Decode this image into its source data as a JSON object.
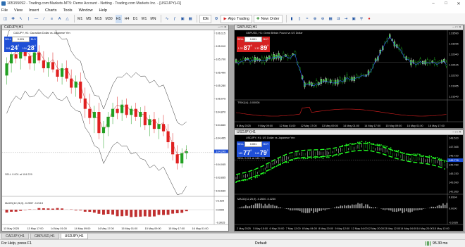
{
  "window": {
    "title": "105155092 - Trading.com:Markets-MT5: Demo Account - Netting - Trading.com Markets Inc. - [USDJPY,H1]"
  },
  "menu": [
    "File",
    "View",
    "Insert",
    "Charts",
    "Tools",
    "Window",
    "Help"
  ],
  "toolbar": {
    "timeframes": [
      "M1",
      "M5",
      "M15",
      "M30",
      "H1",
      "H4",
      "D1",
      "W1",
      "MN"
    ],
    "ide_label": "IDE",
    "algo_label": "Algo Trading",
    "new_order_label": "New Order"
  },
  "charts": [
    {
      "id": "cadjpy",
      "title": "CADJPY,H1",
      "symbol_line": "CADJPY, H1:  Canadian Dollar vs Japanese Yen",
      "otp": {
        "sell": "SELL",
        "buy": "BUY",
        "lot": "0.001",
        "bid_pre": "104",
        "bid_big": "24",
        "bid_sup": "3",
        "ask_pre": "104",
        "ask_big": "28",
        "ask_sup": "4"
      },
      "prices": [
        "106.115",
        "105.910",
        "105.700",
        "105.490",
        "105.280",
        "105.075",
        "104.870",
        "104.660",
        "104.455",
        "104.250",
        "104.045",
        "103.835",
        "103.630"
      ],
      "price_tag": "104.249",
      "sell_label": "SELL 0.001 at 104.229",
      "macd_label": "MACD(12,26,9) -0.2557 -0.2113",
      "macd_axis": [
        "0.1625",
        "0.0000",
        "-0.3025"
      ],
      "dates": [
        "13 May 2025",
        "13 May 17:00",
        "14 May 01:00",
        "14 May 09:00",
        "14 May 17:00",
        "15 May 01:00",
        "15 May 09:00",
        "15 May 17:00",
        "16 May 01:00"
      ],
      "candles": [
        {
          "o": 105.5,
          "h": 105.8,
          "l": 105.35,
          "c": 105.7
        },
        {
          "o": 105.7,
          "h": 105.95,
          "l": 105.55,
          "c": 105.85
        },
        {
          "o": 105.85,
          "h": 106.0,
          "l": 105.7,
          "c": 105.78
        },
        {
          "o": 105.78,
          "h": 105.95,
          "l": 105.6,
          "c": 105.9
        },
        {
          "o": 105.9,
          "h": 106.05,
          "l": 105.75,
          "c": 105.82
        },
        {
          "o": 105.82,
          "h": 105.95,
          "l": 105.6,
          "c": 105.7
        },
        {
          "o": 105.7,
          "h": 105.95,
          "l": 105.58,
          "c": 105.88
        },
        {
          "o": 105.88,
          "h": 106.0,
          "l": 105.7,
          "c": 105.75
        },
        {
          "o": 105.75,
          "h": 105.9,
          "l": 105.55,
          "c": 105.62
        },
        {
          "o": 105.62,
          "h": 105.8,
          "l": 105.48,
          "c": 105.72
        },
        {
          "o": 105.72,
          "h": 105.88,
          "l": 105.55,
          "c": 105.6
        },
        {
          "o": 105.6,
          "h": 105.75,
          "l": 105.4,
          "c": 105.48
        },
        {
          "o": 105.48,
          "h": 105.7,
          "l": 105.35,
          "c": 105.62
        },
        {
          "o": 105.62,
          "h": 105.75,
          "l": 105.4,
          "c": 105.45
        },
        {
          "o": 105.45,
          "h": 105.6,
          "l": 105.2,
          "c": 105.3
        },
        {
          "o": 105.3,
          "h": 105.5,
          "l": 105.15,
          "c": 105.4
        },
        {
          "o": 105.4,
          "h": 105.55,
          "l": 105.05,
          "c": 105.12
        },
        {
          "o": 105.12,
          "h": 105.3,
          "l": 104.8,
          "c": 104.95
        },
        {
          "o": 104.95,
          "h": 105.2,
          "l": 104.7,
          "c": 104.8
        },
        {
          "o": 104.8,
          "h": 105.0,
          "l": 104.55,
          "c": 104.9
        },
        {
          "o": 104.9,
          "h": 105.05,
          "l": 104.45,
          "c": 104.55
        },
        {
          "o": 104.55,
          "h": 104.75,
          "l": 104.3,
          "c": 104.65
        },
        {
          "o": 104.65,
          "h": 104.9,
          "l": 104.5,
          "c": 104.82
        },
        {
          "o": 104.82,
          "h": 105.05,
          "l": 104.7,
          "c": 104.95
        },
        {
          "o": 104.95,
          "h": 105.15,
          "l": 104.78,
          "c": 104.88
        },
        {
          "o": 104.88,
          "h": 105.1,
          "l": 104.75,
          "c": 105.02
        },
        {
          "o": 105.02,
          "h": 105.12,
          "l": 104.8,
          "c": 104.85
        },
        {
          "o": 104.85,
          "h": 105.0,
          "l": 104.7,
          "c": 104.95
        },
        {
          "o": 104.95,
          "h": 105.05,
          "l": 104.75,
          "c": 104.82
        },
        {
          "o": 104.82,
          "h": 104.98,
          "l": 104.65,
          "c": 104.9
        },
        {
          "o": 104.9,
          "h": 105.0,
          "l": 104.6,
          "c": 104.68
        },
        {
          "o": 104.68,
          "h": 104.85,
          "l": 104.5,
          "c": 104.78
        },
        {
          "o": 104.78,
          "h": 104.9,
          "l": 104.55,
          "c": 104.62
        },
        {
          "o": 104.62,
          "h": 104.8,
          "l": 104.45,
          "c": 104.7
        },
        {
          "o": 104.7,
          "h": 104.85,
          "l": 104.5,
          "c": 104.58
        },
        {
          "o": 104.58,
          "h": 104.7,
          "l": 104.3,
          "c": 104.4
        },
        {
          "o": 104.4,
          "h": 104.55,
          "l": 104.1,
          "c": 104.2
        },
        {
          "o": 104.2,
          "h": 104.35,
          "l": 103.95,
          "c": 104.05
        },
        {
          "o": 104.05,
          "h": 104.3,
          "l": 103.98,
          "c": 104.22
        },
        {
          "o": 104.22,
          "h": 104.35,
          "l": 104.12,
          "c": 104.25
        }
      ]
    },
    {
      "id": "gbpusd",
      "title": "GBPUSD,H1",
      "symbol_line": "GBPUSD, H1:  Great Britain Pound vs US Dollar",
      "otp": {
        "sell": "SELL",
        "buy": "BUY",
        "lot": "0.001",
        "bid_pre": "1.32",
        "bid_big": "87",
        "bid_sup": "9",
        "ask_pre": "1.32",
        "ask_big": "89",
        "ask_sup": "9"
      },
      "prices": [
        "1.33590",
        "1.33265",
        "1.32940",
        "1.32615",
        "1.32290",
        "1.31965",
        "1.31640"
      ],
      "trix_label": "TRIX(14) -0.00006",
      "dates": [
        "9 May 2025",
        "9 May 09:00",
        "12 May 01:00",
        "12 May 17:00",
        "13 May 09:00",
        "14 May 01:00",
        "14 May 17:00",
        "15 May 09:00",
        "16 May 01:00",
        "16 May 17:00"
      ]
    },
    {
      "id": "usdjpy",
      "title": "USDJPY,H1",
      "symbol_line": "USDJPY, H1:  US Dollar vs Japanese Yen",
      "otp": {
        "sell": "SELL",
        "buy": "BUY",
        "lot": "0.001",
        "bid_pre": "145",
        "bid_big": "77",
        "bid_sup": "8",
        "ask_pre": "145",
        "ask_big": "79",
        "ask_sup": "2"
      },
      "prices": [
        "148.520",
        "147.365",
        "146.720",
        "145.780",
        "145.230",
        "143.690",
        "142.350"
      ],
      "price_tag": "145.778",
      "sell_label": "SELL 0.001 at 145.778",
      "macd_label": "MACD(12,26,9) -0.2630 -0.2230",
      "macd_axis": [
        "0.8994",
        "0.0000",
        "-0.5395"
      ],
      "dates": [
        "2 May 2025",
        "5 May 15:00",
        "6 May 20:00",
        "7 May 12:00",
        "8 May 04:00",
        "8 May 20:00",
        "9 May 12:00",
        "12 May 04:00",
        "12 May 20:00",
        "13 May 12:00",
        "14 May 04:00",
        "14 May 20:00",
        "15 May 12:00"
      ]
    }
  ],
  "tabs": [
    "CADJPY,H1",
    "GBPUSD,H1",
    "USDJPY,H1"
  ],
  "active_tab": "USDJPY,H1",
  "status": {
    "help": "For Help, press F1",
    "profile": "Default",
    "network": "95.30 ms"
  }
}
